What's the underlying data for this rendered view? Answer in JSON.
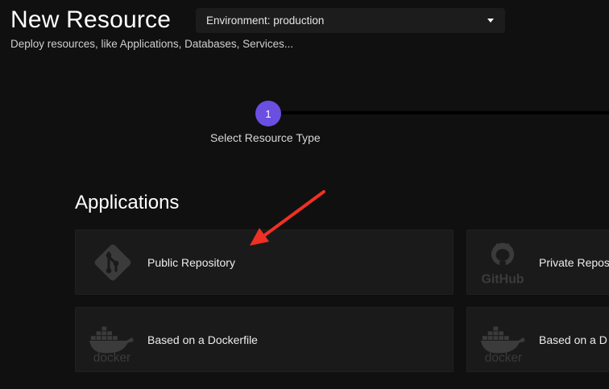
{
  "header": {
    "title": "New Resource",
    "subtitle": "Deploy resources, like Applications, Databases, Services..."
  },
  "environment_select": {
    "label": "Environment: production"
  },
  "stepper": {
    "step_number": "1",
    "step_label": "Select Resource Type",
    "active_color": "#6b4fe0"
  },
  "applications": {
    "heading": "Applications",
    "cards": [
      {
        "label": "Public Repository",
        "icon": "git-icon"
      },
      {
        "label": "Private Repos",
        "icon": "github-icon"
      },
      {
        "label": "Based on a Dockerfile",
        "icon": "docker-icon"
      },
      {
        "label": "Based on a D",
        "icon": "docker-icon"
      }
    ]
  },
  "annotation": {
    "arrow_color": "#ee3124"
  }
}
